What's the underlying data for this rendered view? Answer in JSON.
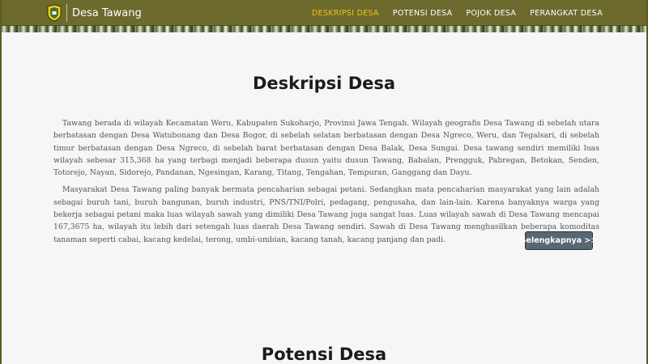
{
  "colors": {
    "navbar_bg": "#6c6a2d",
    "active_nav": "#f1c40f",
    "button_bg": "#576774",
    "page_bg": "#f6f6f6"
  },
  "navbar": {
    "brand_name": "Desa Tawang",
    "logo_icon": "village-emblem-icon",
    "links": [
      {
        "label": "DESKRIPSI DESA",
        "active": true
      },
      {
        "label": "POTENSI DESA",
        "active": false
      },
      {
        "label": "POJOK DESA",
        "active": false
      },
      {
        "label": "PERANGKAT DESA",
        "active": false
      }
    ]
  },
  "deskripsi": {
    "title": "Deskripsi Desa",
    "paragraphs": [
      "Tawang berada di wilayah Kecamatan Weru, Kabupaten Sukoharjo, Provinsi Jawa Tengah. Wilayah geografis Desa Tawang di sebelah utara berbatasan dengan Desa Watubonang dan Desa Bogor, di sebelah selatan berbatasan dengan Desa Ngreco, Weru, dan Tegalsari, di sebelah timur berbatasan dengan Desa Ngreco, di sebelah barat berbatasan dengan Desa Balak, Desa Sungai. Desa tawang sendiri memiliki luas wilayah sebesar 315,368 ha yang terbagi menjadi beberapa dusun yaitu dusun Tawang, Babalan, Prengguk, Pabregan, Betokan, Senden, Totorejo, Nayan, Sidorejo, Pandanan, Ngesingan, Karang, Titang, Tengahan, Tempuran, Ganggang dan Dayu.",
      "Masyarakat Desa Tawang paling banyak bermata pencaharian sebagai petani. Sedangkan mata pencaharian masyarakat yang lain adalah sebagai buruh tani, buruh bangunan, buruh industri, PNS/TNI/Polri, pedagang, pengusaha, dan lain-lain. Karena banyaknya warga yang bekerja sebagai petani maka luas wilayah sawah yang dimiliki Desa Tawang juga sangat luas. Luas wilayah sawah di Desa Tawang mencapai 167,3675 ha, wilayah itu lebih dari setengah luas daerah Desa Tawang sendiri. Sawah di Desa Tawang menghasilkan beberapa komoditas tanaman seperti cabai, kacang kedelai, terong, umbi-umbian, kacang tanah, kacang panjang dan padi."
    ],
    "button_label": "Selengkapnya >>"
  },
  "potensi": {
    "title": "Potensi Desa"
  }
}
